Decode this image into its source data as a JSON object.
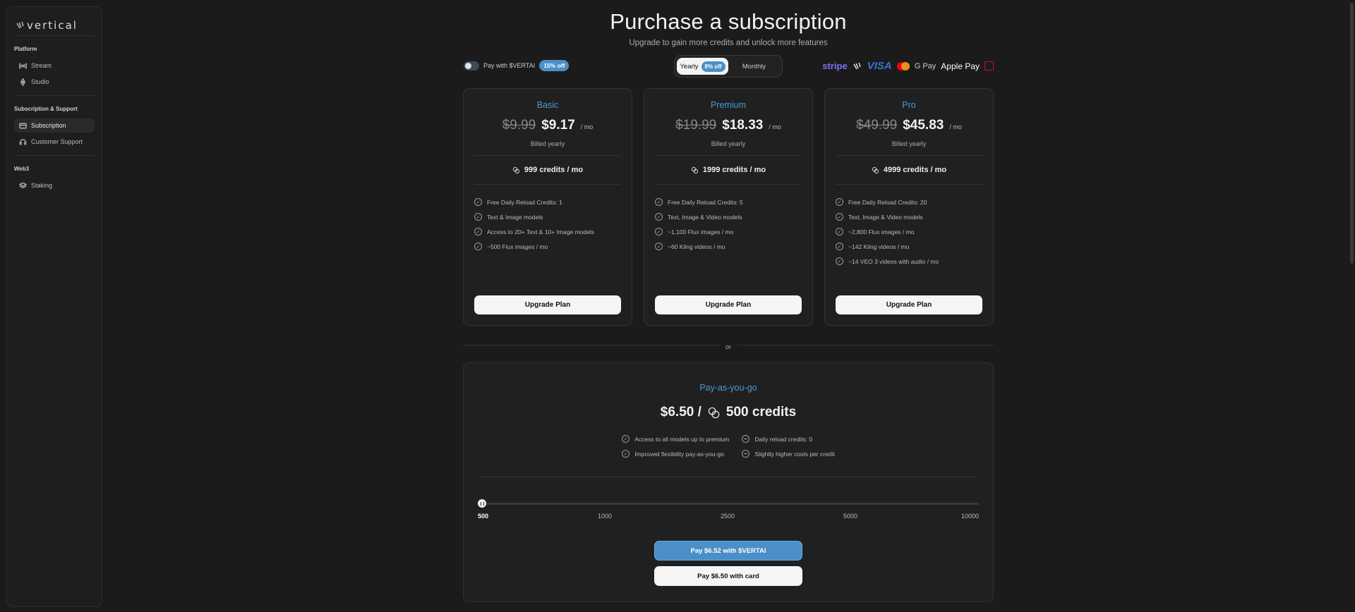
{
  "app": {
    "logo_text": "vertical"
  },
  "sidebar": {
    "sections": [
      {
        "title": "Platform",
        "items": [
          {
            "label": "Stream",
            "icon": "stream-icon"
          },
          {
            "label": "Studio",
            "icon": "studio-icon"
          }
        ]
      },
      {
        "title": "Subscription & Support",
        "items": [
          {
            "label": "Subscription",
            "icon": "card-icon",
            "active": true
          },
          {
            "label": "Customer Support",
            "icon": "headset-icon"
          }
        ]
      },
      {
        "title": "Web3",
        "items": [
          {
            "label": "Staking",
            "icon": "layers-icon"
          }
        ]
      }
    ]
  },
  "header": {
    "title": "Purchase a subscription",
    "subtitle": "Upgrade to gain more credits and unlock more features"
  },
  "controls": {
    "pay_vertai_label": "Pay with $VERTAI",
    "pay_vertai_badge": "15% off",
    "billing_yearly": "Yearly",
    "billing_yearly_badge": "8% off",
    "billing_monthly": "Monthly",
    "payment_logos": [
      "stripe",
      "vertical",
      "VISA",
      "mastercard",
      "G Pay",
      "Apple Pay",
      "iDEAL"
    ]
  },
  "plans": [
    {
      "name": "Basic",
      "old_price": "$9.99",
      "price": "$9.17",
      "per": "/ mo",
      "billed": "Billed yearly",
      "credits": "999 credits / mo",
      "features": [
        "Free Daily Reload Credits: 1",
        "Text & Image models",
        "Access to 20+ Text & 10+ Image models",
        "~500 Flux images / mo"
      ],
      "button": "Upgrade Plan"
    },
    {
      "name": "Premium",
      "old_price": "$19.99",
      "price": "$18.33",
      "per": "/ mo",
      "billed": "Billed yearly",
      "credits": "1999 credits / mo",
      "features": [
        "Free Daily Reload Credits: 5",
        "Text, Image & Video models",
        "~1,100 Flux images / mo",
        "~60 Kling videos / mo"
      ],
      "button": "Upgrade Plan"
    },
    {
      "name": "Pro",
      "old_price": "$49.99",
      "price": "$45.83",
      "per": "/ mo",
      "billed": "Billed yearly",
      "credits": "4999 credits / mo",
      "features": [
        "Free Daily Reload Credits: 20",
        "Text, Image & Video models",
        "~2,800 Flux images / mo",
        "~142 Kling videos / mo",
        "~14 VEO 3 videos with audio / mo"
      ],
      "button": "Upgrade Plan"
    }
  ],
  "divider": {
    "or_label": "or"
  },
  "payg": {
    "name": "Pay-as-you-go",
    "price": "$6.50 /",
    "credits": "500 credits",
    "features_left": [
      "Access to all models up to premium",
      "Improved flexibility pay-as-you-go"
    ],
    "features_right": [
      "Daily reload credits: 0",
      "Slightly higher costs per credit"
    ],
    "slider": {
      "ticks": [
        "500",
        "1000",
        "2500",
        "5000",
        "10000"
      ],
      "selected": "500"
    },
    "btn_vertai": "Pay $6.52 with $VERTAI",
    "btn_card": "Pay $6.50 with card"
  },
  "colors": {
    "accent": "#4a8fc7",
    "bg": "#1b1b1b",
    "card": "#202020"
  }
}
